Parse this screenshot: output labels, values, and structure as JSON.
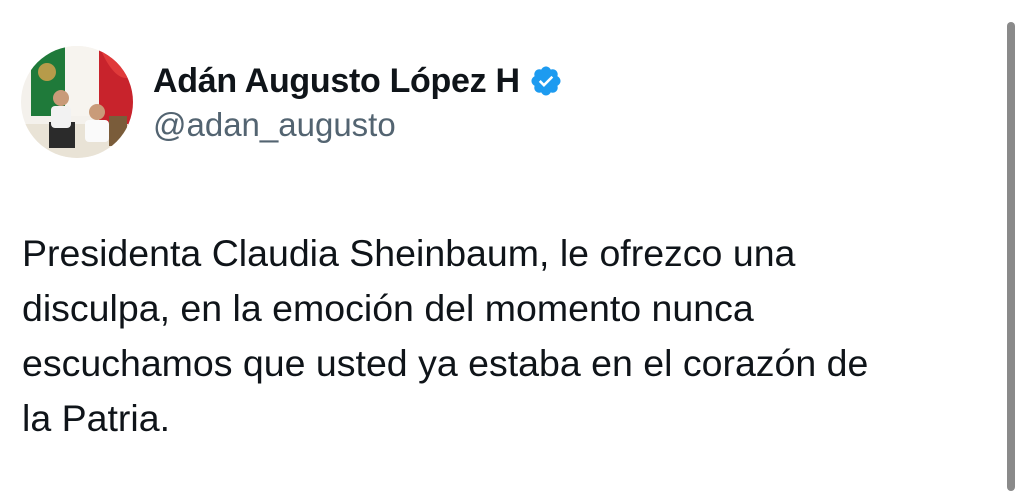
{
  "author": {
    "display_name": "Adán Augusto López H",
    "handle": "@adan_augusto",
    "verified_icon": "verified-badge-icon",
    "avatar_icon": "profile-photo"
  },
  "tweet": {
    "lines": [
      "Presidenta Claudia Sheinbaum, le ofrezco una",
      "disculpa, en la emoción del momento nunca",
      "escuchamos que usted ya estaba en el corazón de",
      "la Patria."
    ]
  },
  "colors": {
    "text": "#0f1419",
    "secondary_text": "#536471",
    "verified_blue": "#1d9bf0",
    "background": "#ffffff"
  }
}
